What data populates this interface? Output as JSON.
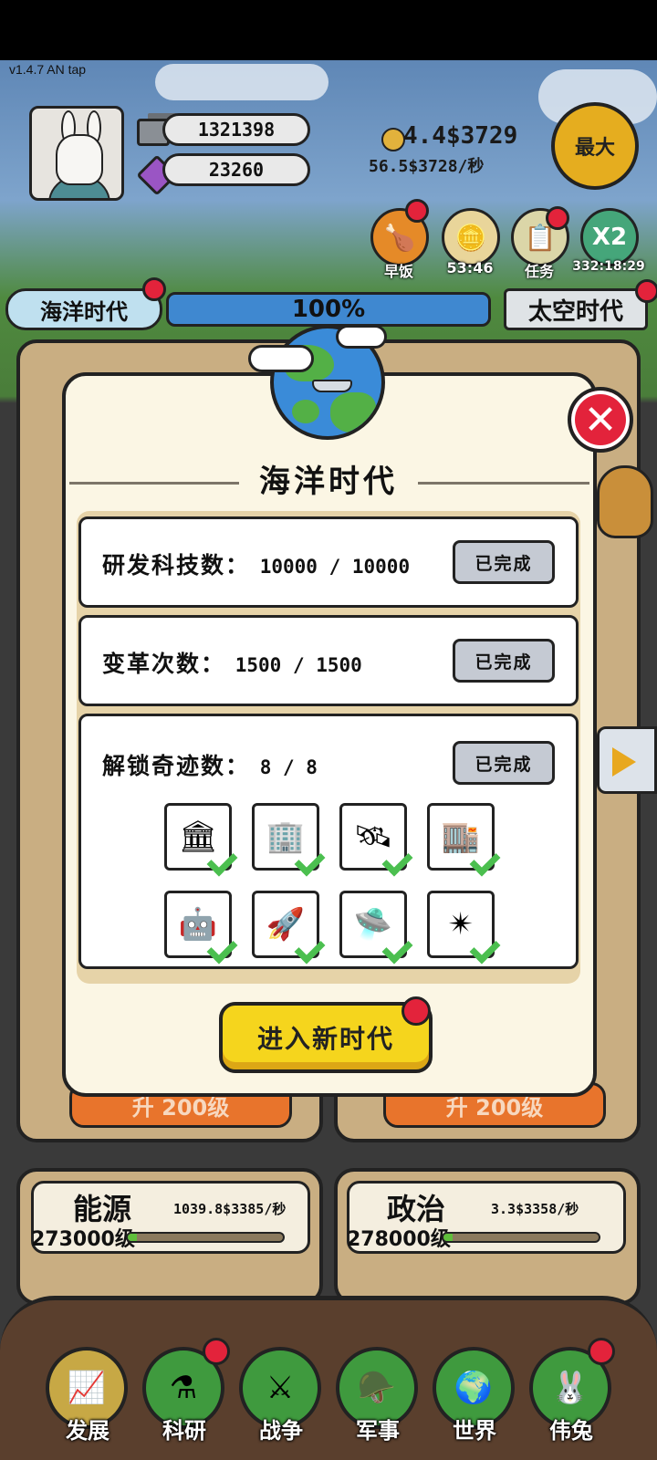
{
  "version": "v1.4.7 AN tap",
  "resources": {
    "iron": "1321398",
    "gems": "23260"
  },
  "income": {
    "main": "4.4$3729",
    "per_sec": "56.5$3728/秒"
  },
  "max_button": "最大",
  "quick_buttons": [
    {
      "label": "早饭",
      "icon": "drumstick-icon"
    },
    {
      "label": "53:46",
      "icon": "coin-icon"
    },
    {
      "label": "任务",
      "icon": "clipboard-icon"
    },
    {
      "label": "332:18:29",
      "icon": "x2-icon",
      "icon_text": "X2"
    }
  ],
  "era": {
    "current": "海洋时代",
    "progress": "100%",
    "progress_value": 1.0,
    "next": "太空时代"
  },
  "bg_cards": {
    "energy": {
      "title": "能源",
      "rate": "1039.8$3385/秒",
      "level": "273000级",
      "upgrade": ""
    },
    "politics": {
      "title": "政治",
      "rate": "3.3$3358/秒",
      "level": "278000级"
    },
    "upgrade_label": "升 200级"
  },
  "modal": {
    "title": "海洋时代",
    "requirements": [
      {
        "label": "研发科技数：",
        "value": "10000 / 10000",
        "status": "已完成"
      },
      {
        "label": "变革次数：",
        "value": "1500 / 1500",
        "status": "已完成"
      },
      {
        "label": "解锁奇迹数：",
        "value": "8 / 8",
        "status": "已完成"
      }
    ],
    "wonders": [
      "🏛",
      "🏢",
      "🛰",
      "🏬",
      "🤖",
      "🚀",
      "🛸",
      "✴"
    ],
    "enter_button": "进入新时代",
    "close_icon": "✕"
  },
  "nav": [
    {
      "label": "发展",
      "icon": "📈",
      "active": true
    },
    {
      "label": "科研",
      "icon": "⚗"
    },
    {
      "label": "战争",
      "icon": "⚔"
    },
    {
      "label": "军事",
      "icon": "🪖"
    },
    {
      "label": "世界",
      "icon": "🌍"
    },
    {
      "label": "伟兔",
      "icon": "🐰"
    }
  ]
}
